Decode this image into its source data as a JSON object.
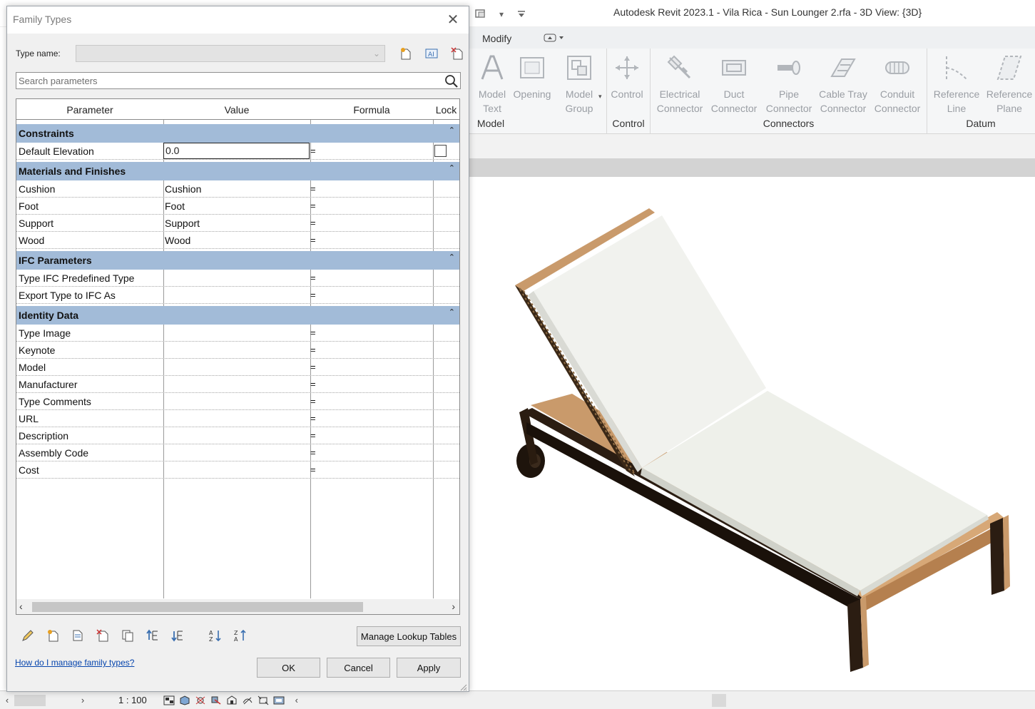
{
  "app": {
    "title": "Autodesk Revit 2023.1 - Vila Rica - Sun Lounger 2.rfa - 3D View: {3D}"
  },
  "ribbon": {
    "tab_modify": "Modify",
    "buttons": [
      {
        "line1": "Model",
        "line2": "Text"
      },
      {
        "line1": "Opening",
        "line2": ""
      },
      {
        "line1": "Model",
        "line2": "Group"
      },
      {
        "line1": "Control",
        "line2": ""
      },
      {
        "line1": "Electrical",
        "line2": "Connector"
      },
      {
        "line1": "Duct",
        "line2": "Connector"
      },
      {
        "line1": "Pipe",
        "line2": "Connector"
      },
      {
        "line1": "Cable Tray",
        "line2": "Connector"
      },
      {
        "line1": "Conduit",
        "line2": "Connector"
      },
      {
        "line1": "Reference",
        "line2": "Line"
      },
      {
        "line1": "Reference",
        "line2": "Plane"
      }
    ],
    "groups": [
      "Model",
      "Control",
      "Connectors",
      "Datum"
    ]
  },
  "status_bar": {
    "scale": "1 : 100"
  },
  "dialog": {
    "title": "Family Types",
    "type_name_label": "Type name:",
    "type_name_value": "",
    "search_placeholder": "Search parameters",
    "columns": {
      "parameter": "Parameter",
      "value": "Value",
      "formula": "Formula",
      "lock": "Lock"
    },
    "groups": [
      {
        "name": "Constraints",
        "rows": [
          {
            "parameter": "Default Elevation",
            "value": "0.0",
            "formula": "=",
            "has_lock": true,
            "editing": true
          }
        ]
      },
      {
        "name": "Materials and Finishes",
        "rows": [
          {
            "parameter": "Cushion",
            "value": "Cushion",
            "formula": "="
          },
          {
            "parameter": "Foot",
            "value": "Foot",
            "formula": "="
          },
          {
            "parameter": "Support",
            "value": "Support",
            "formula": "="
          },
          {
            "parameter": "Wood",
            "value": "Wood",
            "formula": "="
          }
        ]
      },
      {
        "name": "IFC Parameters",
        "rows": [
          {
            "parameter": "Type IFC Predefined Type",
            "value": "",
            "formula": "="
          },
          {
            "parameter": "Export Type to IFC As",
            "value": "",
            "formula": "="
          }
        ]
      },
      {
        "name": "Identity Data",
        "rows": [
          {
            "parameter": "Type Image",
            "value": "",
            "formula": "="
          },
          {
            "parameter": "Keynote",
            "value": "",
            "formula": "="
          },
          {
            "parameter": "Model",
            "value": "",
            "formula": "="
          },
          {
            "parameter": "Manufacturer",
            "value": "",
            "formula": "="
          },
          {
            "parameter": "Type Comments",
            "value": "",
            "formula": "="
          },
          {
            "parameter": "URL",
            "value": "",
            "formula": "="
          },
          {
            "parameter": "Description",
            "value": "",
            "formula": "="
          },
          {
            "parameter": "Assembly Code",
            "value": "",
            "formula": "="
          },
          {
            "parameter": "Cost",
            "value": "",
            "formula": "="
          }
        ]
      }
    ],
    "buttons": {
      "manage_lookup": "Manage Lookup Tables",
      "ok": "OK",
      "cancel": "Cancel",
      "apply": "Apply"
    },
    "help_link": "How do I manage family types?"
  },
  "colors": {
    "group_header": "#a2bbd8",
    "link": "#0645ad",
    "ribbon_disabled": "#9a9ea4"
  }
}
